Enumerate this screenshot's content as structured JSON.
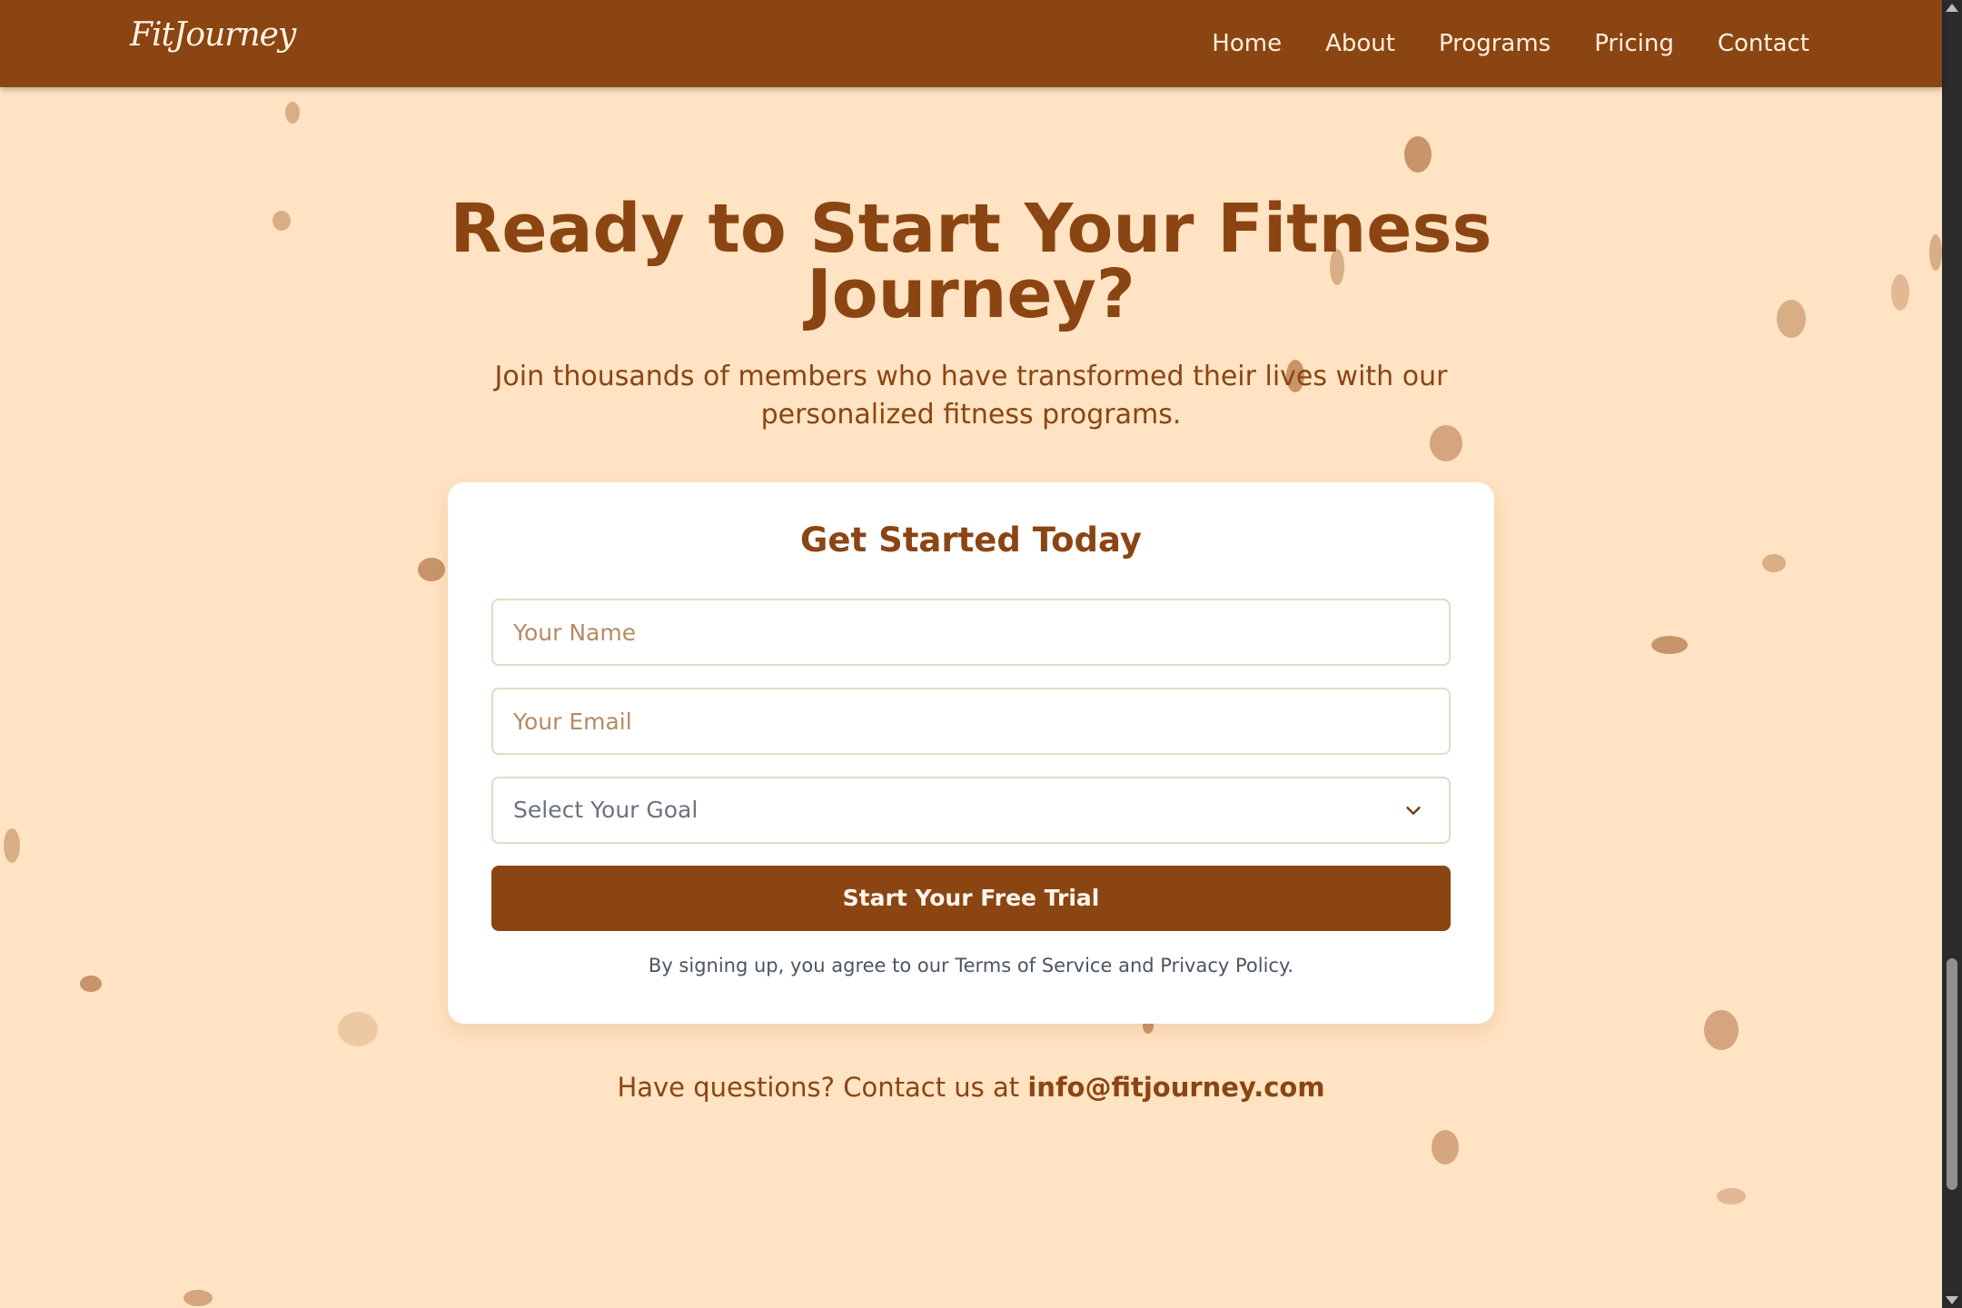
{
  "brand": {
    "logo_text": "FitJourney"
  },
  "nav": {
    "items": [
      {
        "label": "Home"
      },
      {
        "label": "About"
      },
      {
        "label": "Programs"
      },
      {
        "label": "Pricing"
      },
      {
        "label": "Contact"
      }
    ]
  },
  "hero": {
    "title_line1": "Ready to Start Your Fitness",
    "title_line2": "Journey?",
    "subtitle_line1": "Join thousands of members who have transformed their lives with our",
    "subtitle_line2": "personalized fitness programs."
  },
  "form": {
    "title": "Get Started Today",
    "name_placeholder": "Your Name",
    "email_placeholder": "Your Email",
    "goal_placeholder": "Select Your Goal",
    "submit_label": "Start Your Free Trial",
    "terms": "By signing up, you agree to our Terms of Service and Privacy Policy."
  },
  "contact": {
    "prefix": "Have questions? Contact us at ",
    "email": "info@fitjourney.com"
  },
  "colors": {
    "brand": "#8B4513",
    "background": "#FFE3C2",
    "card": "#FFFFFF",
    "dot_dark": "#C8956A",
    "dot_light": "#E3B894"
  },
  "icons": {
    "select_chevron": "chevron-down-icon"
  }
}
